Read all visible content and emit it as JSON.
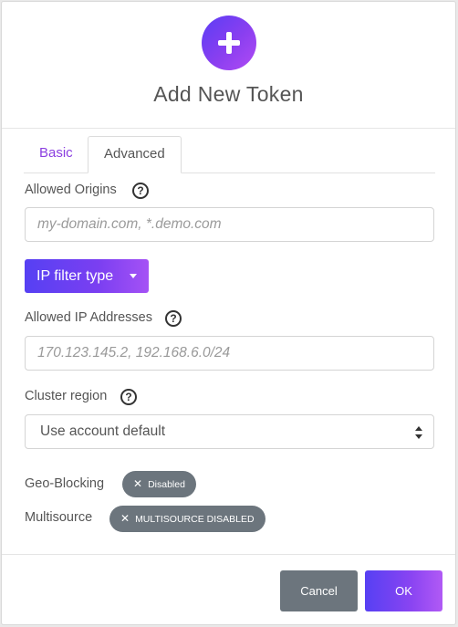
{
  "modal": {
    "title": "Add New Token",
    "header_icon": "plus-icon",
    "accent_color": "#7a3ff2"
  },
  "tabs": [
    {
      "label": "Basic",
      "active": false
    },
    {
      "label": "Advanced",
      "active": true
    }
  ],
  "allowed_origins": {
    "label": "Allowed Origins",
    "help": "?",
    "placeholder": "my-domain.com, *.demo.com",
    "value": ""
  },
  "ip_filter": {
    "button_label": "IP filter type"
  },
  "allowed_ips": {
    "label": "Allowed IP Addresses",
    "help": "?",
    "placeholder": "170.123.145.2, 192.168.6.0/24",
    "value": ""
  },
  "cluster_region": {
    "label": "Cluster region",
    "help": "?",
    "selected": "Use account default"
  },
  "geo_blocking": {
    "label": "Geo-Blocking",
    "badge_icon": "x-icon",
    "badge": "Disabled"
  },
  "multisource": {
    "label": "Multisource",
    "badge_icon": "x-icon",
    "badge": "MULTISOURCE DISABLED"
  },
  "footer": {
    "cancel_label": "Cancel",
    "ok_label": "OK"
  }
}
